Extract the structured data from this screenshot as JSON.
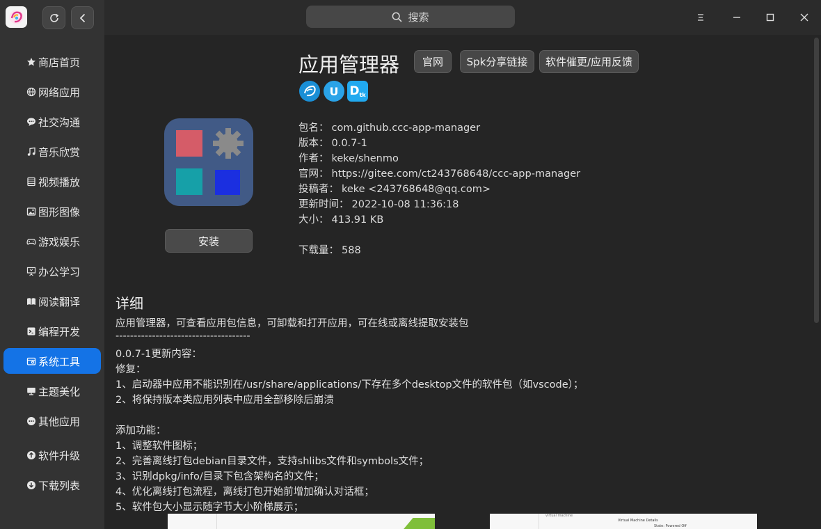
{
  "search": {
    "label": "搜索"
  },
  "sidebar": {
    "items": [
      {
        "label": "商店首页",
        "icon": "star-icon"
      },
      {
        "label": "网络应用",
        "icon": "globe-icon"
      },
      {
        "label": "社交沟通",
        "icon": "chat-icon"
      },
      {
        "label": "音乐欣赏",
        "icon": "music-icon"
      },
      {
        "label": "视频播放",
        "icon": "video-icon"
      },
      {
        "label": "图形图像",
        "icon": "image-icon"
      },
      {
        "label": "游戏娱乐",
        "icon": "gamepad-icon"
      },
      {
        "label": "办公学习",
        "icon": "presentation-icon"
      },
      {
        "label": "阅读翻译",
        "icon": "book-icon"
      },
      {
        "label": "编程开发",
        "icon": "terminal-icon"
      },
      {
        "label": "系统工具",
        "icon": "toolbox-icon"
      },
      {
        "label": "主题美化",
        "icon": "monitor-icon"
      },
      {
        "label": "其他应用",
        "icon": "more-icon"
      },
      {
        "label": "软件升级",
        "icon": "upgrade-icon"
      },
      {
        "label": "下载列表",
        "icon": "download-icon"
      }
    ],
    "active": "系统工具"
  },
  "app": {
    "name": "应用管理器",
    "buttons": {
      "official": "官网",
      "share": "Spk分享链接",
      "feedback": "软件催更/应用反馈"
    },
    "badges": [
      "deepin-icon",
      "uos-icon",
      "dtk-icon"
    ],
    "badge_text": {
      "uos": "U",
      "dtk": "D",
      "dtk_sub": "tk"
    },
    "install_label": "安装",
    "info": {
      "package": {
        "key": "包名：",
        "value": "com.github.ccc-app-manager"
      },
      "version": {
        "key": "版本：",
        "value": "0.0.7-1"
      },
      "author": {
        "key": "作者：",
        "value": "keke/shenmo"
      },
      "website": {
        "key": "官网：",
        "value": "https://gitee.com/ct243768648/ccc-app-manager"
      },
      "contributor": {
        "key": "投稿者：",
        "value": "keke <243768648@qq.com>"
      },
      "updated": {
        "key": "更新时间：",
        "value": "2022-10-08 11:36:18"
      },
      "size": {
        "key": "大小：",
        "value": "413.91 KB"
      },
      "downloads": {
        "key": "下载量：",
        "value": "588"
      }
    }
  },
  "details": {
    "title": "详细",
    "lines": [
      "应用管理器，可查看应用包信息，可卸载和打开应用，可在线或离线提取安装包",
      "-------------------------------------",
      "0.0.7-1更新内容：",
      "修复：",
      "1、启动器中应用不能识别在/usr/share/applications/下存在多个desktop文件的软件包（如vscode）；",
      "2、将保持版本类应用列表中应用全部移除后崩溃",
      "",
      "添加功能：",
      "1、调整软件图标；",
      "2、完善离线打包debian目录文件，支持shlibs文件和symbols文件；",
      "3、识别dpkg/info/目录下包含架构名的文件；",
      "4、优化离线打包流程，离线打包开始前增加确认对话框；",
      "5、软件包大小显示随字节大小阶梯展示；"
    ]
  },
  "screenshots": {
    "second": {
      "label_top": "virtual machine",
      "heading": "Virtual Machine Details",
      "state_key": "State:",
      "state_value": "Powered Off"
    }
  },
  "colors": {
    "accent": "#1473e6",
    "sidebar_bg": "#333333",
    "content_bg": "#252525"
  }
}
